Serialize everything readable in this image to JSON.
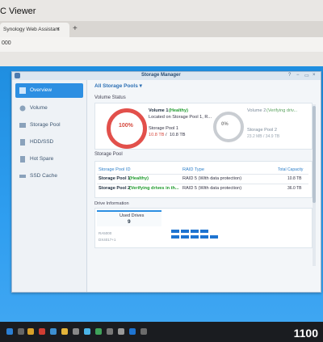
{
  "browser": {
    "title": "C Viewer",
    "tab_label": "Synology Web Assistant",
    "tab_close": "×",
    "new_tab": "+",
    "address": "000"
  },
  "window": {
    "title": "Storage Manager",
    "controls": [
      "?",
      "−",
      "▭",
      "×"
    ]
  },
  "sidebar": {
    "items": [
      {
        "label": "Overview",
        "icon": "overview-icon",
        "active": true
      },
      {
        "label": "Volume",
        "icon": "volume-icon",
        "active": false
      },
      {
        "label": "Storage Pool",
        "icon": "storage-pool-icon",
        "active": false
      },
      {
        "label": "HDD/SSD",
        "icon": "hdd-icon",
        "active": false
      },
      {
        "label": "Hot Spare",
        "icon": "hot-spare-icon",
        "active": false
      },
      {
        "label": "SSD Cache",
        "icon": "ssd-cache-icon",
        "active": false
      }
    ]
  },
  "main": {
    "dropdown_label": "All Storage Pools",
    "dropdown_arrow": "▾",
    "volume_status_label": "Volume Status",
    "volume1": {
      "percent": "100%",
      "name": "Volume 1",
      "status": "(Healthy)",
      "location": "Located on Storage Pool 1, R...",
      "pool": "Storage Pool 1",
      "used": "10.8 TB",
      "sep": "/",
      "total": "10.8 TB"
    },
    "volume2": {
      "percent": "0%",
      "name": "Volume 2",
      "status": "(Verifying driv...",
      "pool": "Storage Pool 2",
      "usage": "23.2 MB / 34.9 TB"
    },
    "storage_pool_label": "Storage Pool",
    "pool_table": {
      "headers": [
        "Storage Pool ID",
        "RAID Type",
        "Total Capacity"
      ],
      "rows": [
        {
          "id": "Storage Pool 1",
          "status": "(Healthy)",
          "raid": "RAID 5 (With data protection)",
          "capacity": "10.8 TB"
        },
        {
          "id": "Storage Pool 2",
          "status": "(Verifying drives in th...",
          "raid": "RAID 5 (With data protection)",
          "capacity": "36.0 TB"
        }
      ]
    },
    "drive_info_label": "Drive Information",
    "used_drives_label": "Used Drives",
    "used_drives_count": "9",
    "device_label_1": "RA5000",
    "device_label_2": "DX4017+1"
  },
  "overlay_text": "1100",
  "colors": {
    "accent": "#2d8fe2",
    "healthy": "#1e9a2c",
    "volume_ring": "#e2504b",
    "desktop": "#2f9ef0"
  }
}
